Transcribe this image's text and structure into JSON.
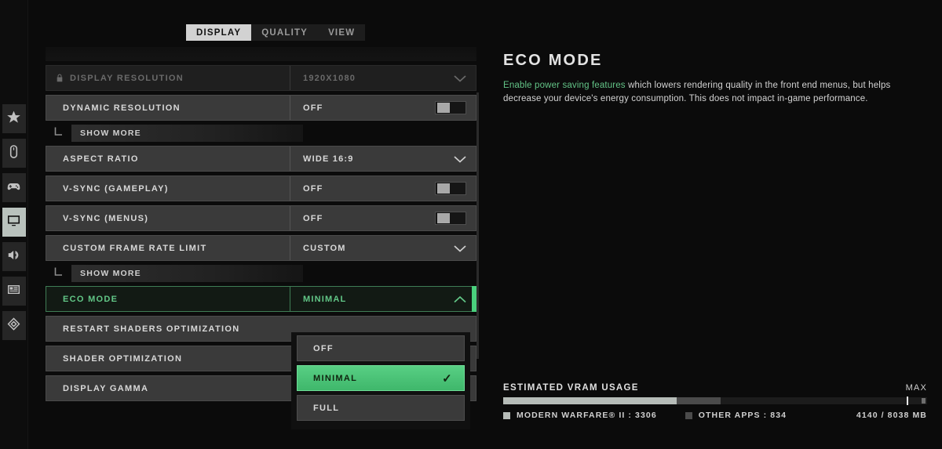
{
  "tabs": [
    {
      "label": "DISPLAY",
      "active": true
    },
    {
      "label": "QUALITY",
      "active": false
    },
    {
      "label": "VIEW",
      "active": false
    }
  ],
  "rail": {
    "items": [
      {
        "icon": "star-icon",
        "active": false
      },
      {
        "icon": "mouse-icon",
        "active": false
      },
      {
        "icon": "gamepad-icon",
        "active": false
      },
      {
        "icon": "monitor-icon",
        "active": true
      },
      {
        "icon": "speaker-icon",
        "active": false
      },
      {
        "icon": "interface-icon",
        "active": false
      },
      {
        "icon": "telemetry-icon",
        "active": false
      }
    ]
  },
  "settings": {
    "display_resolution": {
      "label": "DISPLAY RESOLUTION",
      "value": "1920X1080",
      "locked": true
    },
    "dynamic_resolution": {
      "label": "DYNAMIC RESOLUTION",
      "value": "OFF"
    },
    "dynamic_resolution_more": {
      "label": "SHOW MORE"
    },
    "aspect_ratio": {
      "label": "ASPECT RATIO",
      "value": "WIDE 16:9"
    },
    "vsync_gameplay": {
      "label": "V-SYNC (GAMEPLAY)",
      "value": "OFF"
    },
    "vsync_menus": {
      "label": "V-SYNC (MENUS)",
      "value": "OFF"
    },
    "custom_frame_rate_limit": {
      "label": "CUSTOM FRAME RATE LIMIT",
      "value": "CUSTOM"
    },
    "custom_frame_rate_more": {
      "label": "SHOW MORE"
    },
    "eco_mode": {
      "label": "ECO MODE",
      "value": "MINIMAL",
      "selected": true
    },
    "restart_shaders": {
      "label": "RESTART SHADERS OPTIMIZATION"
    },
    "shader_optimization": {
      "label": "SHADER OPTIMIZATION"
    },
    "display_gamma": {
      "label": "DISPLAY GAMMA"
    }
  },
  "dropdown": {
    "options": [
      {
        "label": "OFF",
        "selected": false
      },
      {
        "label": "MINIMAL",
        "selected": true
      },
      {
        "label": "FULL",
        "selected": false
      }
    ],
    "check_glyph": "✓"
  },
  "info": {
    "title": "ECO MODE",
    "desc_highlight": "Enable power saving features",
    "desc_rest": " which lowers rendering quality in the front end menus, but helps decrease your device's energy consumption. This does not impact in-game performance."
  },
  "vram": {
    "title": "ESTIMATED VRAM USAGE",
    "max_label": "MAX",
    "game_legend": "MODERN WARFARE® II : 3306",
    "other_legend": "OTHER APPS : 834",
    "total": "4140 / 8038 MB"
  },
  "colors": {
    "accent_green": "#4ad07d",
    "text_green": "#62c787",
    "row_bg": "#3a3a3a"
  }
}
